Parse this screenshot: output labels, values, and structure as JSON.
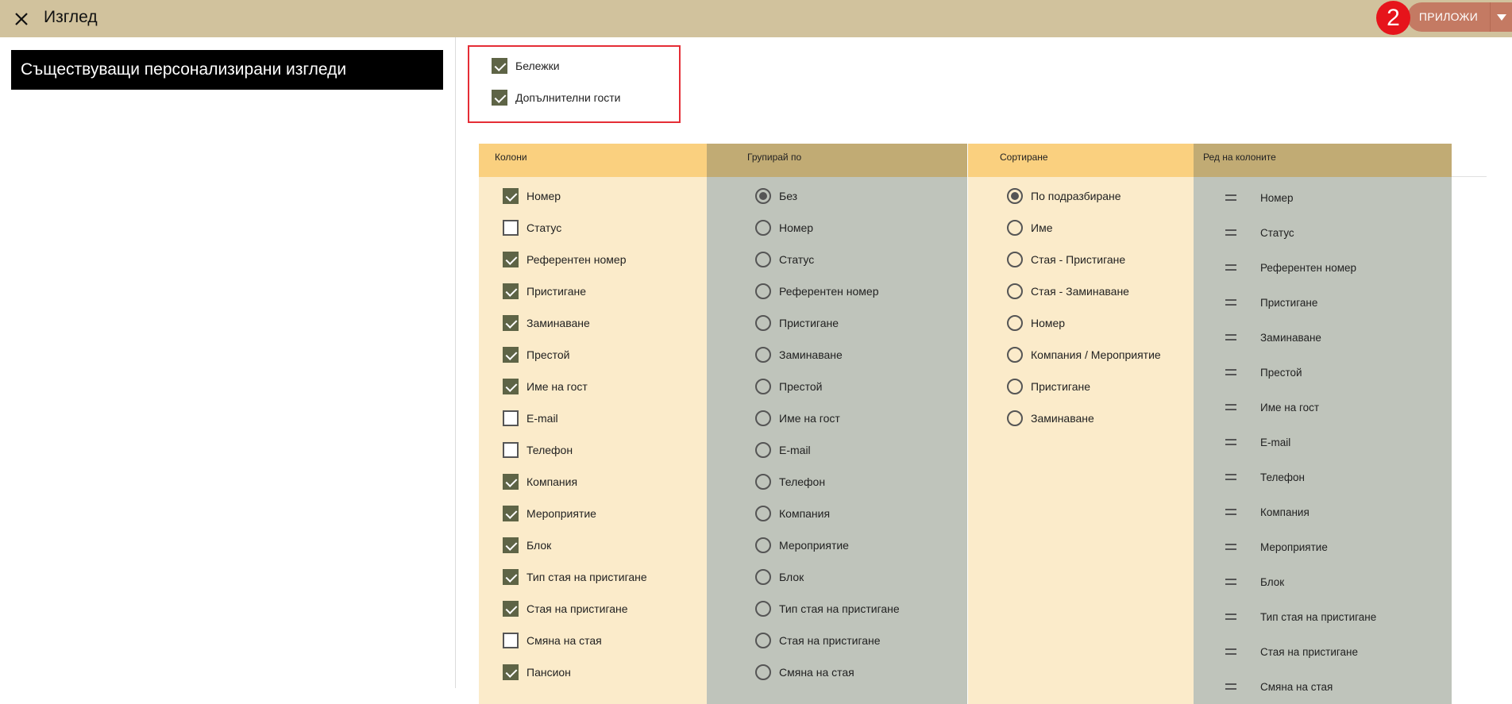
{
  "header": {
    "title": "Изглед",
    "step_badge": "2",
    "apply_label": "ПРИЛОЖИ"
  },
  "left": {
    "existing_views_title": "Съществуващи персонализирани изгледи"
  },
  "options": [
    {
      "label": "Бележки",
      "checked": true
    },
    {
      "label": "Допълнителни гости",
      "checked": true
    }
  ],
  "columns_panel": {
    "header": "Колони",
    "items": [
      {
        "label": "Номер",
        "checked": true
      },
      {
        "label": "Статус",
        "checked": false
      },
      {
        "label": "Референтен номер",
        "checked": true
      },
      {
        "label": "Пристигане",
        "checked": true
      },
      {
        "label": "Заминаване",
        "checked": true
      },
      {
        "label": "Престой",
        "checked": true
      },
      {
        "label": "Име на гост",
        "checked": true
      },
      {
        "label": "E-mail",
        "checked": false
      },
      {
        "label": "Телефон",
        "checked": false
      },
      {
        "label": "Компания",
        "checked": true
      },
      {
        "label": "Мероприятие",
        "checked": true
      },
      {
        "label": "Блок",
        "checked": true
      },
      {
        "label": "Тип стая на пристигане",
        "checked": true
      },
      {
        "label": "Стая на пристигане",
        "checked": true
      },
      {
        "label": "Смяна на стая",
        "checked": false
      },
      {
        "label": "Пансион",
        "checked": true
      }
    ]
  },
  "group_panel": {
    "header": "Групирай по",
    "selected_index": 0,
    "items": [
      "Без",
      "Номер",
      "Статус",
      "Референтен номер",
      "Пристигане",
      "Заминаване",
      "Престой",
      "Име на гост",
      "E-mail",
      "Телефон",
      "Компания",
      "Мероприятие",
      "Блок",
      "Тип стая на пристигане",
      "Стая на пристигане",
      "Смяна на стая"
    ]
  },
  "sort_panel": {
    "header": "Сортиране",
    "selected_index": 0,
    "items": [
      "По подразбиране",
      "Име",
      "Стая - Пристигане",
      "Стая - Заминаване",
      "Номер",
      "Компания / Мероприятие",
      "Пристигане",
      "Заминаване"
    ]
  },
  "order_panel": {
    "header": "Ред на колоните",
    "items": [
      "Номер",
      "Статус",
      "Референтен номер",
      "Пристигане",
      "Заминаване",
      "Престой",
      "Име на гост",
      "E-mail",
      "Телефон",
      "Компания",
      "Мероприятие",
      "Блок",
      "Тип стая на пристигане",
      "Стая на пристигане",
      "Смяна на стая"
    ]
  },
  "colors": {
    "header_bg": "#d1c29d",
    "accent_button": "#c47a63",
    "badge_red": "#e6141b",
    "checkbox_fill": "#5e6446",
    "panel_light": "#fbebca",
    "panel_gray": "#bfc4bb"
  }
}
